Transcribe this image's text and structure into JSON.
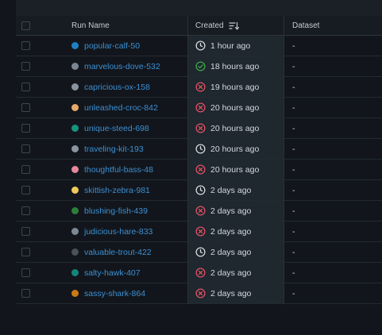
{
  "columns": {
    "name": "Run Name",
    "created": "Created",
    "dataset": "Dataset"
  },
  "colors": {
    "link": "#3c8fd3",
    "success": "#3fa54a",
    "failed": "#e05263",
    "running": "#d4d9de"
  },
  "runs": [
    {
      "name": "popular-calf-50",
      "color": "#1f7fc4",
      "status": "clock-icon",
      "created": "1 hour ago",
      "dataset": "-"
    },
    {
      "name": "marvelous-dove-532",
      "color": "#7b8592",
      "status": "check-icon",
      "created": "18 hours ago",
      "dataset": "-"
    },
    {
      "name": "capricious-ox-158",
      "color": "#8a949e",
      "status": "x-circle-icon",
      "created": "19 hours ago",
      "dataset": "-"
    },
    {
      "name": "unleashed-croc-842",
      "color": "#e9a86a",
      "status": "x-circle-icon",
      "created": "20 hours ago",
      "dataset": "-"
    },
    {
      "name": "unique-steed-698",
      "color": "#17927f",
      "status": "x-circle-icon",
      "created": "20 hours ago",
      "dataset": "-"
    },
    {
      "name": "traveling-kit-193",
      "color": "#8b95a0",
      "status": "clock-icon",
      "created": "20 hours ago",
      "dataset": "-"
    },
    {
      "name": "thoughtful-bass-48",
      "color": "#e6869a",
      "status": "x-circle-icon",
      "created": "20 hours ago",
      "dataset": "-"
    },
    {
      "name": "skittish-zebra-981",
      "color": "#f0c95a",
      "status": "clock-icon",
      "created": "2 days ago",
      "dataset": "-"
    },
    {
      "name": "blushing-fish-439",
      "color": "#2f7d3b",
      "status": "x-circle-icon",
      "created": "2 days ago",
      "dataset": "-"
    },
    {
      "name": "judicious-hare-833",
      "color": "#7e8894",
      "status": "x-circle-icon",
      "created": "2 days ago",
      "dataset": "-"
    },
    {
      "name": "valuable-trout-422",
      "color": "#4a5159",
      "status": "clock-icon",
      "created": "2 days ago",
      "dataset": "-"
    },
    {
      "name": "salty-hawk-407",
      "color": "#14857a",
      "status": "x-circle-icon",
      "created": "2 days ago",
      "dataset": "-"
    },
    {
      "name": "sassy-shark-864",
      "color": "#c97a14",
      "status": "x-circle-icon",
      "created": "2 days ago",
      "dataset": "-"
    }
  ]
}
